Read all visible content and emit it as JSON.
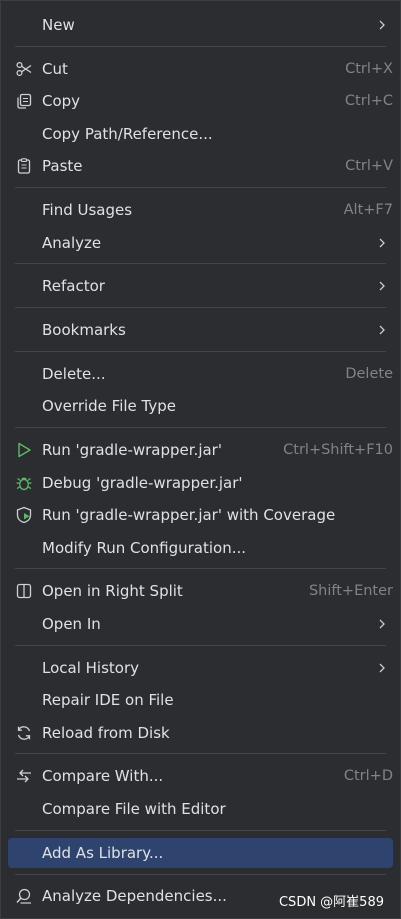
{
  "menu": {
    "items": [
      {
        "label": "New",
        "shortcut": "",
        "submenu": true,
        "icon": ""
      },
      {
        "label": "Cut",
        "shortcut": "Ctrl+X",
        "submenu": false,
        "icon": "scissors-icon"
      },
      {
        "label": "Copy",
        "shortcut": "Ctrl+C",
        "submenu": false,
        "icon": "copy-icon"
      },
      {
        "label": "Copy Path/Reference...",
        "shortcut": "",
        "submenu": false,
        "icon": ""
      },
      {
        "label": "Paste",
        "shortcut": "Ctrl+V",
        "submenu": false,
        "icon": "clipboard-icon"
      },
      {
        "label": "Find Usages",
        "shortcut": "Alt+F7",
        "submenu": false,
        "icon": ""
      },
      {
        "label": "Analyze",
        "shortcut": "",
        "submenu": true,
        "icon": ""
      },
      {
        "label": "Refactor",
        "shortcut": "",
        "submenu": true,
        "icon": ""
      },
      {
        "label": "Bookmarks",
        "shortcut": "",
        "submenu": true,
        "icon": ""
      },
      {
        "label": "Delete...",
        "shortcut": "Delete",
        "submenu": false,
        "icon": ""
      },
      {
        "label": "Override File Type",
        "shortcut": "",
        "submenu": false,
        "icon": ""
      },
      {
        "label": "Run 'gradle-wrapper.jar'",
        "shortcut": "Ctrl+Shift+F10",
        "submenu": false,
        "icon": "run-icon"
      },
      {
        "label": "Debug 'gradle-wrapper.jar'",
        "shortcut": "",
        "submenu": false,
        "icon": "debug-bug-icon"
      },
      {
        "label": "Run 'gradle-wrapper.jar' with Coverage",
        "shortcut": "",
        "submenu": false,
        "icon": "coverage-shield-icon"
      },
      {
        "label": "Modify Run Configuration...",
        "shortcut": "",
        "submenu": false,
        "icon": ""
      },
      {
        "label": "Open in Right Split",
        "shortcut": "Shift+Enter",
        "submenu": false,
        "icon": "split-icon"
      },
      {
        "label": "Open In",
        "shortcut": "",
        "submenu": true,
        "icon": ""
      },
      {
        "label": "Local History",
        "shortcut": "",
        "submenu": true,
        "icon": ""
      },
      {
        "label": "Repair IDE on File",
        "shortcut": "",
        "submenu": false,
        "icon": ""
      },
      {
        "label": "Reload from Disk",
        "shortcut": "",
        "submenu": false,
        "icon": "reload-icon"
      },
      {
        "label": "Compare With...",
        "shortcut": "Ctrl+D",
        "submenu": false,
        "icon": "compare-icon"
      },
      {
        "label": "Compare File with Editor",
        "shortcut": "",
        "submenu": false,
        "icon": ""
      },
      {
        "label": "Add As Library...",
        "shortcut": "",
        "submenu": false,
        "icon": "",
        "selected": true
      },
      {
        "label": "Analyze Dependencies...",
        "shortcut": "",
        "submenu": false,
        "icon": "analyze-dependencies-icon"
      }
    ]
  },
  "watermark": "CSDN @阿崔589",
  "colors": {
    "background": "#2b2d30",
    "text": "#dfe1e5",
    "shortcut": "#808389",
    "separator": "#43454a",
    "selection": "#2e436e",
    "run_green": "#5fb865"
  }
}
